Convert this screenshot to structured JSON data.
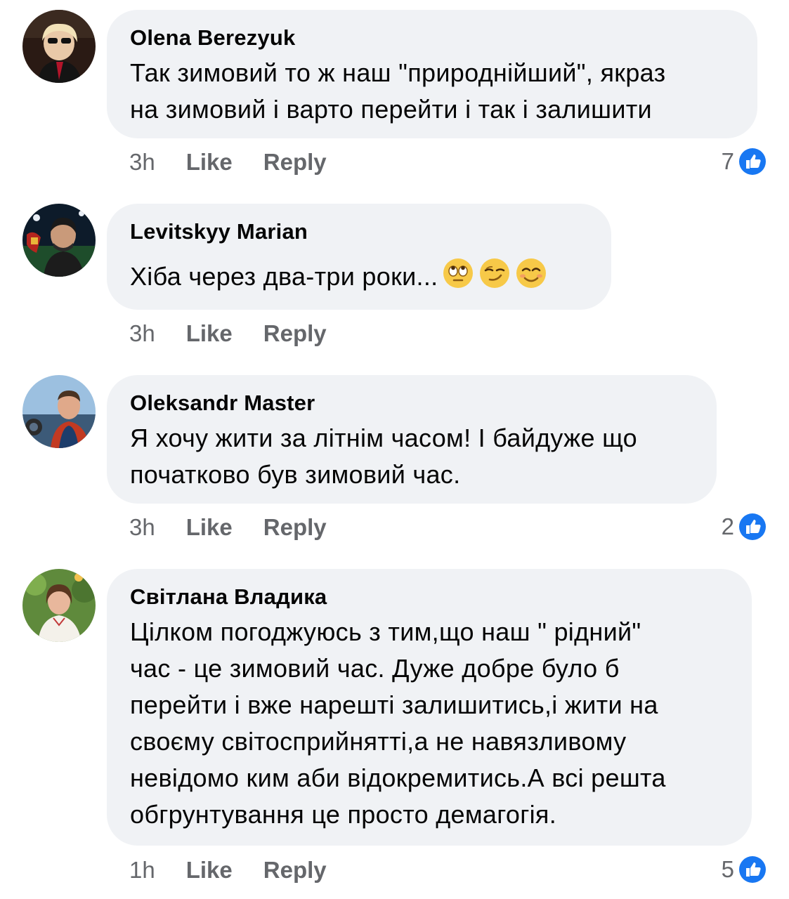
{
  "colors": {
    "bubble": "#f0f2f5",
    "meta_text": "#65676b",
    "like_blue": "#1877f2"
  },
  "comments": [
    {
      "author": "Olena Berezyuk",
      "lines": [
        "Так зимовий то ж наш \"природнійший\", якраз",
        "на зимовий і варто перейти і так і залишити"
      ],
      "time": "3h",
      "like": "Like",
      "reply": "Reply",
      "reaction_count": "7",
      "reaction_icon": "like-icon"
    },
    {
      "author": "Levitskyy Marian",
      "lines": [
        "Хіба через два-три роки..."
      ],
      "emojis": [
        "eye-roll-emoji",
        "smirk-emoji",
        "smile-emoji"
      ],
      "time": "3h",
      "like": "Like",
      "reply": "Reply"
    },
    {
      "author": "Oleksandr Master",
      "lines": [
        "Я хочу жити за літнім часом! І байдуже що",
        "початково був зимовий час."
      ],
      "time": "3h",
      "like": "Like",
      "reply": "Reply",
      "reaction_count": "2",
      "reaction_icon": "like-icon"
    },
    {
      "author": "Світлана Владика",
      "lines": [
        "Цілком погоджуюсь з тим,що наш \" рідний\"",
        "час - це зимовий час. Дуже добре було б",
        "перейти і вже нарешті залишитись,і жити на",
        "своєму світосприйнятті,а не навязливому",
        "невідомо ким аби відокремитись.А всі решта",
        "обгрунтування це просто демагогія."
      ],
      "time": "1h",
      "like": "Like",
      "reply": "Reply",
      "reaction_count": "5",
      "reaction_icon": "like-icon"
    }
  ]
}
